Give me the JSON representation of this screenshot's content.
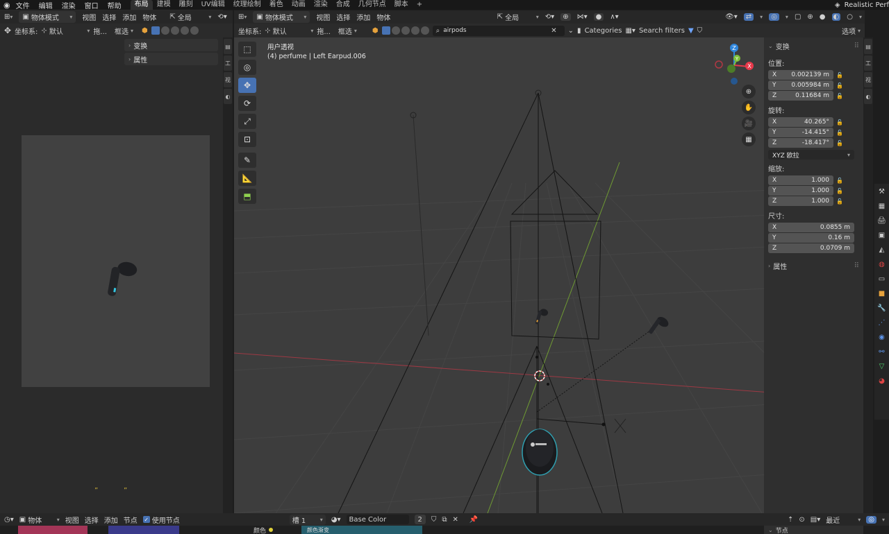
{
  "menu": {
    "items": [
      "文件",
      "编辑",
      "渲染",
      "窗口",
      "帮助"
    ],
    "workspaces": [
      "布局",
      "建模",
      "雕刻",
      "UV编辑",
      "纹理绘制",
      "着色",
      "动画",
      "渲染",
      "合成",
      "几何节点",
      "脚本"
    ],
    "active_workspace": "布局",
    "add_tab": "+",
    "render_engine": "Realistic Perf"
  },
  "left_editor": {
    "mode": "物体模式",
    "menus": [
      "视图",
      "选择",
      "添加",
      "物体"
    ],
    "global": "全局",
    "coord_label": "坐标系:",
    "coord_value": "默认",
    "drag_label": "拖...",
    "select_box": "框选",
    "panels": [
      "变换",
      "属性"
    ],
    "quote_marks": [
      "”",
      "”"
    ]
  },
  "viewport": {
    "mode": "物体模式",
    "menus": [
      "视图",
      "选择",
      "添加",
      "物体"
    ],
    "global": "全局",
    "coord_label": "坐标系:",
    "coord_value": "默认",
    "drag_label": "拖...",
    "select_box": "框选",
    "search_value": "airpods",
    "categories": "Categories",
    "search_filters": "Search filters",
    "options": "选项",
    "view_name": "用户透视",
    "object_info": "(4) perfume | Left Earpud.006",
    "gizmo": {
      "z": "Z",
      "y": "Y",
      "x": "X"
    }
  },
  "npanel": {
    "header": "变换",
    "location_label": "位置:",
    "location": [
      [
        "X",
        "0.002139 m"
      ],
      [
        "Y",
        "0.005984 m"
      ],
      [
        "Z",
        "0.11684 m"
      ]
    ],
    "rotation_label": "旋转:",
    "rotation": [
      [
        "X",
        "40.265°"
      ],
      [
        "Y",
        "-14.415°"
      ],
      [
        "Z",
        "-18.417°"
      ]
    ],
    "rotation_mode": "XYZ 欧拉",
    "scale_label": "缩放:",
    "scale": [
      [
        "X",
        "1.000"
      ],
      [
        "Y",
        "1.000"
      ],
      [
        "Z",
        "1.000"
      ]
    ],
    "dims_label": "尺寸:",
    "dims": [
      [
        "X",
        "0.0855 m"
      ],
      [
        "Y",
        "0.16 m"
      ],
      [
        "Z",
        "0.0709 m"
      ]
    ],
    "properties": "属性"
  },
  "bottom": {
    "mode": "物体",
    "menus": [
      "视图",
      "选择",
      "添加",
      "节点"
    ],
    "use_nodes": "使用节点",
    "slot": "槽 1",
    "material": "Base Color",
    "users": "2",
    "recent": "最近",
    "color_label": "颜色",
    "node_label": "颜色渐变",
    "nodes_panel": "节点"
  },
  "colors": {
    "accent": "#4772b3",
    "axis_x": "#e8394b",
    "axis_y": "#7ec03a",
    "axis_z": "#2f86dc"
  }
}
